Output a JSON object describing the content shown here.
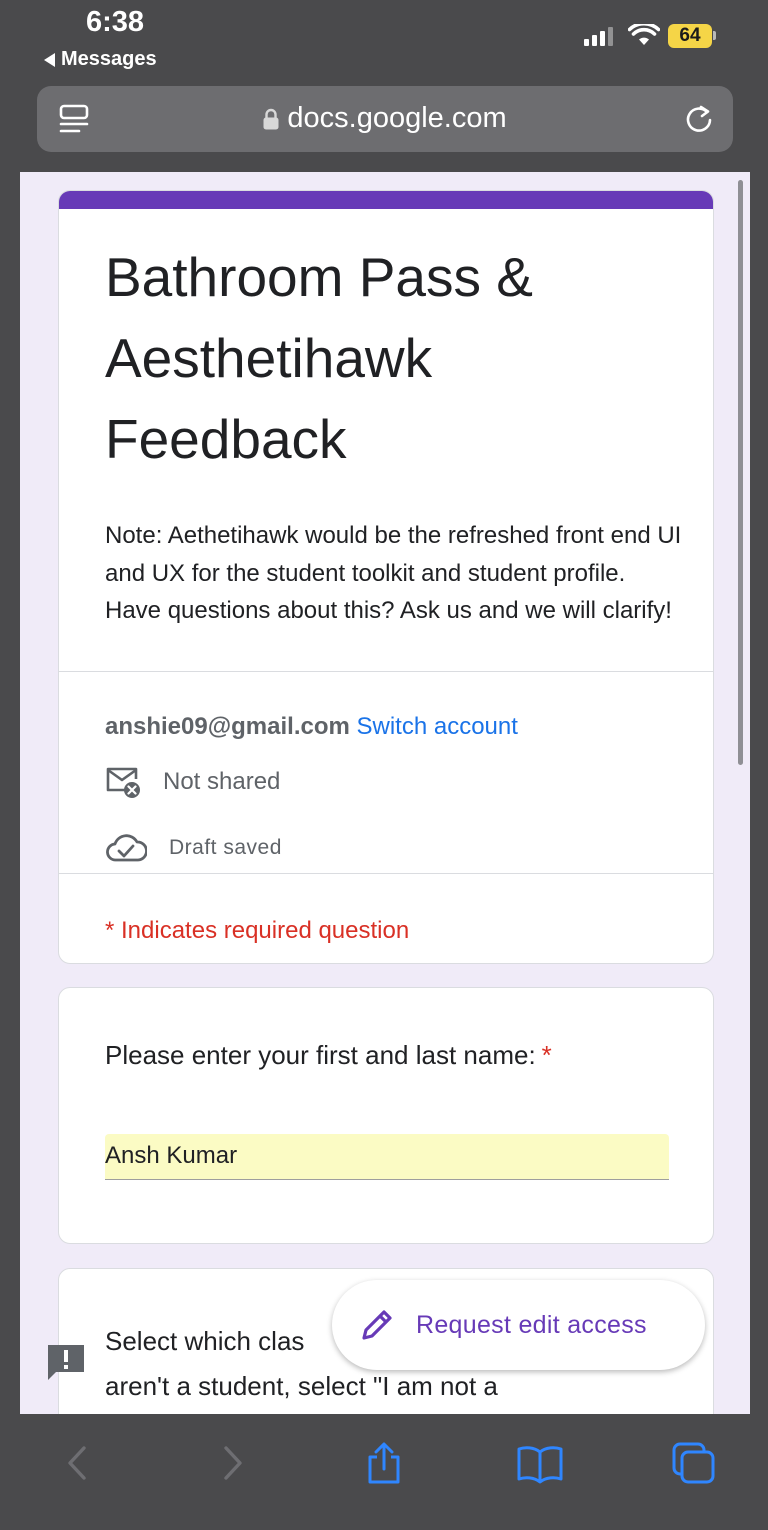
{
  "status_bar": {
    "time": "6:38",
    "back_app": "Messages",
    "battery": "64"
  },
  "browser": {
    "url": "docs.google.com"
  },
  "form": {
    "title": "Bathroom Pass & Aesthetihawk Feedback",
    "description": "Note: Aethetihawk would be the refreshed front end UI and UX for the student toolkit and student profile. Have questions about this? Ask us and we will clarify!",
    "account_email": "anshie09@gmail.com",
    "switch_account": "Switch account",
    "not_shared": "Not shared",
    "draft_saved": "Draft saved",
    "required_note": "* Indicates required question",
    "accent_color": "#673ab7"
  },
  "questions": [
    {
      "label": "Please enter your first and last name:",
      "required_mark": "*",
      "answer": "Ansh Kumar"
    },
    {
      "label_part1": "Select which clas",
      "label_part2": "aren't a student, select \"I am not a"
    }
  ],
  "fab": {
    "label": "Request edit access"
  }
}
